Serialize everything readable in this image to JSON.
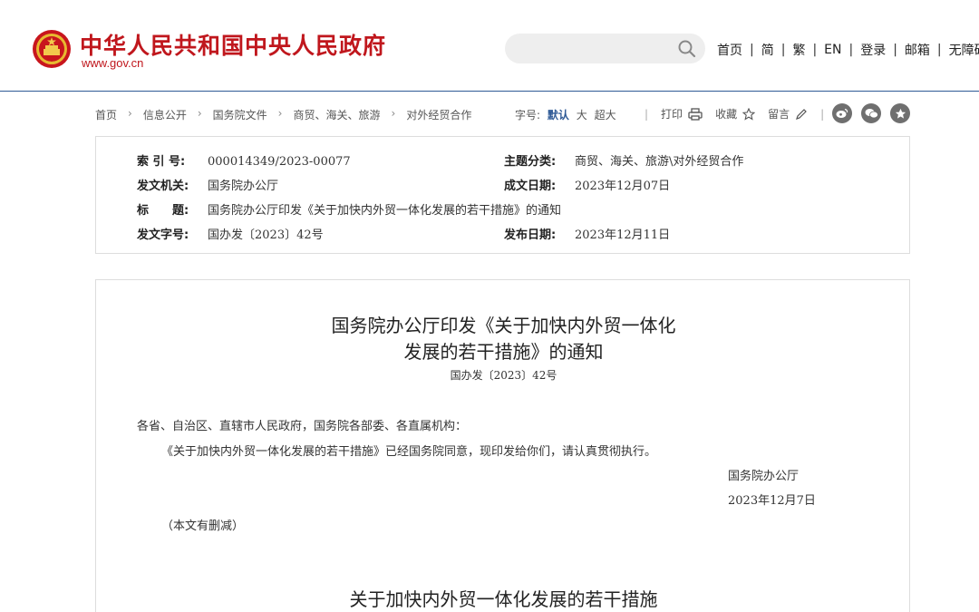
{
  "header": {
    "site_title": "中华人民共和国中央人民政府",
    "site_domain": "www.gov.cn",
    "search_placeholder": "",
    "nav": [
      "首页",
      "简",
      "繁",
      "EN",
      "登录",
      "邮箱",
      "无障碍"
    ]
  },
  "breadcrumb": {
    "items": [
      "首页",
      "信息公开",
      "国务院文件",
      "商贸、海关、旅游",
      "对外经贸合作"
    ]
  },
  "font_size": {
    "label": "字号:",
    "options": [
      "默认",
      "大",
      "超大"
    ],
    "selected": "默认"
  },
  "tools": {
    "print": "打印",
    "favorite": "收藏",
    "comment": "留言"
  },
  "social": [
    "weibo-icon",
    "wechat-icon",
    "star-icon"
  ],
  "meta": {
    "index_label": "索 引 号:",
    "index_value": "000014349/2023-00077",
    "topic_label": "主题分类:",
    "topic_value": "商贸、海关、旅游\\对外经贸合作",
    "issuer_label": "发文机关:",
    "issuer_value": "国务院办公厅",
    "written_label": "成文日期:",
    "written_value": "2023年12月07日",
    "title_label": "标　　题:",
    "title_value": "国务院办公厅印发《关于加快内外贸一体化发展的若干措施》的通知",
    "docno_label": "发文字号:",
    "docno_value": "国办发〔2023〕42号",
    "publish_label": "发布日期:",
    "publish_value": "2023年12月11日"
  },
  "document": {
    "title_line1": "国务院办公厅印发《关于加快内外贸一体化",
    "title_line2": "发展的若干措施》的通知",
    "number": "国办发〔2023〕42号",
    "salutation": "各省、自治区、直辖市人民政府，国务院各部委、各直属机构：",
    "body": "《关于加快内外贸一体化发展的若干措施》已经国务院同意，现印发给你们，请认真贯彻执行。",
    "signer": "国务院办公厅",
    "date": "2023年12月7日",
    "note": "（本文有删减）",
    "subtitle": "关于加快内外贸一体化发展的若干措施"
  },
  "colors": {
    "brand_red": "#c0171d",
    "accent_blue": "#2f5a96"
  }
}
